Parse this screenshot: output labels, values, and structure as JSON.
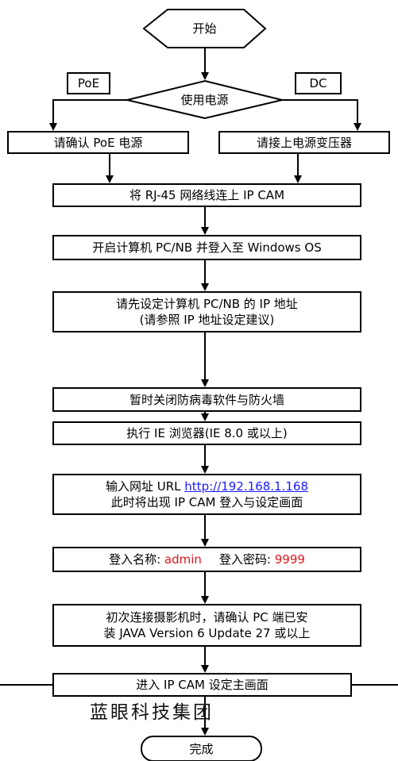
{
  "flow": {
    "start": "开始",
    "power_decision": "使用电源",
    "poe_tag": "PoE",
    "dc_tag": "DC",
    "poe_step": "请确认 PoE 电源",
    "dc_step": "请接上电源变压器",
    "step_connect": "将 RJ-45 网络线连上 IP CAM",
    "step_login_pc": "开启计算机 PC/NB 并登入至 Windows OS",
    "step_ip_line1": "请先设定计算机 PC/NB 的 IP 地址",
    "step_ip_line2": "(请参照 IP 地址设定建议)",
    "step_firewall": "暂时关闭防病毒软件与防火墙",
    "step_browser": "执行 IE 浏览器(IE 8.0 或以上)",
    "step_url_prefix": "输入网址 URL ",
    "step_url_link": "http://192.168.1.168",
    "step_url_line2": "此时将出现 IP CAM 登入与设定画面",
    "step_cred_name_label": "登入名称: ",
    "step_cred_name_value": "admin",
    "step_cred_pwd_label": "登入密码: ",
    "step_cred_pwd_value": "9999",
    "step_java_line1": "初次连接摄影机时，请确认 PC 端已安",
    "step_java_line2": "装 JAVA Version 6 Update 27 或以上",
    "step_main": "进入 IP CAM 设定主画面",
    "end": "完成"
  },
  "watermark": "蓝眼科技集团",
  "colors": {
    "highlight": "#e0161b",
    "link": "#1a1aff"
  }
}
